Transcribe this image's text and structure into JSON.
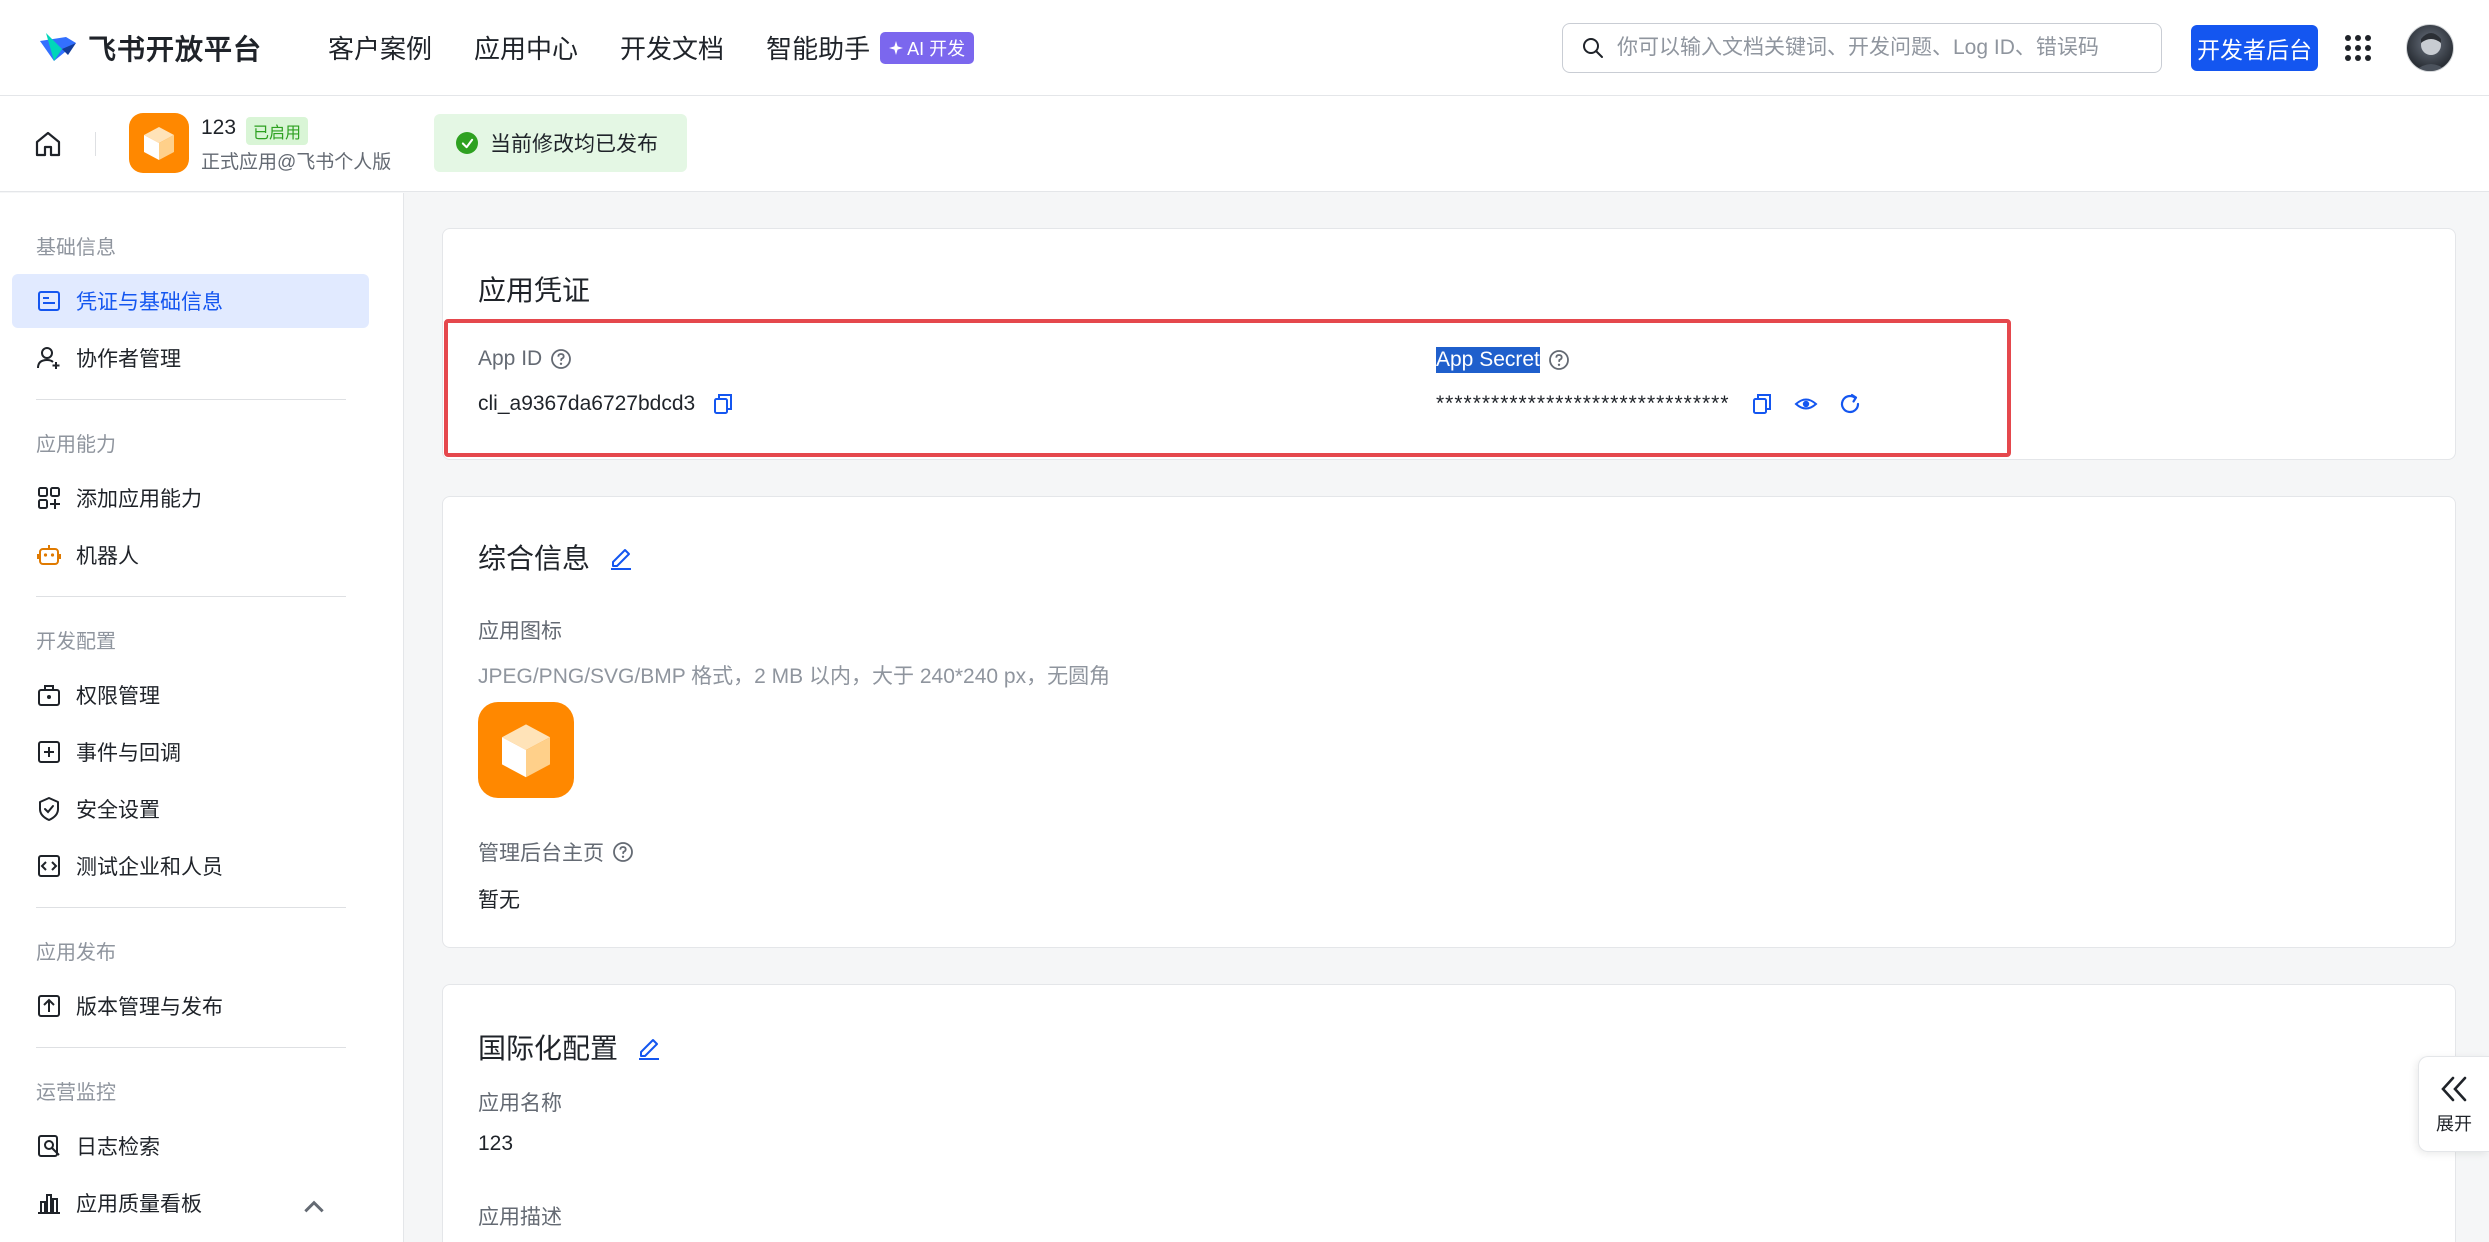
{
  "brand": {
    "name": "飞书开放平台"
  },
  "nav": {
    "links": [
      "客户案例",
      "应用中心",
      "开发文档",
      "智能助手"
    ],
    "ai_badge": "AI 开发"
  },
  "search": {
    "placeholder": "你可以输入文档关键词、开发问题、Log ID、错误码"
  },
  "dev_console_button": "开发者后台",
  "app": {
    "name": "123",
    "status": "已启用",
    "subtitle": "正式应用@飞书个人版"
  },
  "publish_status": "当前修改均已发布",
  "sidebar": {
    "groups": {
      "basic": "基础信息",
      "capability": "应用能力",
      "dev": "开发配置",
      "release": "应用发布",
      "ops": "运营监控"
    },
    "items": {
      "credentials": "凭证与基础信息",
      "collaborators": "协作者管理",
      "add_capability": "添加应用能力",
      "bot": "机器人",
      "permissions": "权限管理",
      "events": "事件与回调",
      "security": "安全设置",
      "test_org": "测试企业和人员",
      "versions": "版本管理与发布",
      "logs": "日志检索",
      "quality": "应用质量看板"
    }
  },
  "credentials_card": {
    "title": "应用凭证",
    "app_id_label": "App ID",
    "app_id_value": "cli_a9367da6727bdcd3",
    "app_secret_label": "App Secret",
    "app_secret_value": "********************************"
  },
  "general_card": {
    "title": "综合信息",
    "icon_label": "应用图标",
    "icon_hint": "JPEG/PNG/SVG/BMP 格式，2 MB 以内，大于 240*240 px，无圆角",
    "admin_home_label": "管理后台主页",
    "admin_home_value": "暂无"
  },
  "i18n_card": {
    "title": "国际化配置",
    "app_name_label": "应用名称",
    "app_name_value": "123",
    "app_desc_label": "应用描述"
  },
  "expand_tab_label": "展开",
  "colors": {
    "accent": "#1456f0",
    "app_icon": "#ff8800",
    "highlight": "#e5484d",
    "success": "#2ea121"
  }
}
